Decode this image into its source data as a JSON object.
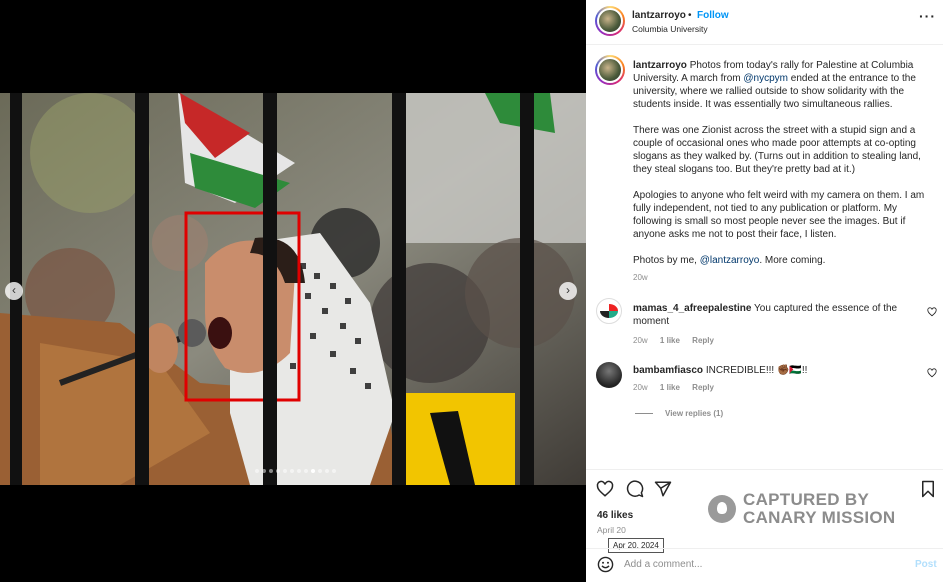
{
  "post": {
    "username": "lantzarroyo",
    "separator": "•",
    "follow_label": "Follow",
    "location": "Columbia University",
    "more_icon": "more-horizontal-icon"
  },
  "caption": {
    "username": "lantzarroyo",
    "p1_a": "Photos from today's rally for Palestine at Columbia University. A march from ",
    "p1_mention": "@nycpym",
    "p1_b": " ended at the entrance to the university, where we rallied outside to show solidarity with the students inside. It was essentially two simultaneous rallies.",
    "p2": "There was one Zionist across the street with a stupid sign and a couple of occasional ones who made poor attempts at co-opting slogans as they walked by. (Turns out in addition to stealing land, they steal slogans too. But they're pretty bad at it.)",
    "p3": "Apologies to anyone who felt weird with my camera on them. I am fully independent, not tied to any publication or platform. My following is small so most people never see the images. But if anyone asks me not to post their face, I listen.",
    "p4_a": "Photos by me, ",
    "p4_mention": "@lantzarroyo",
    "p4_b": ". More coming.",
    "time": "20w"
  },
  "comments": [
    {
      "username": "mamas_4_afreepalestine",
      "text": "You captured the essence of the moment",
      "time": "20w",
      "likes": "1 like",
      "reply": "Reply"
    },
    {
      "username": "bambamfiasco",
      "text": "INCREDIBLE!!! ✊🏾🇵🇸!!",
      "time": "20w",
      "likes": "1 like",
      "reply": "Reply"
    }
  ],
  "view_replies": "View replies (1)",
  "actions": {
    "like_icon": "heart-icon",
    "comment_icon": "comment-icon",
    "share_icon": "share-icon",
    "save_icon": "bookmark-icon"
  },
  "likes": "46 likes",
  "date": "April 20",
  "tooltip": "Apr 20, 2024",
  "comment_box": {
    "placeholder": "Add a comment...",
    "post_label": "Post",
    "emoji_icon": "emoji-icon"
  },
  "watermark": {
    "line1": "CAPTURED BY",
    "line2": "CANARY MISSION"
  },
  "carousel": {
    "prev_icon": "chevron-left-icon",
    "next_icon": "chevron-right-icon",
    "total": 12,
    "active_index": 8,
    "highlight_color": "#e00000"
  },
  "colors": {
    "accent": "#0095f6",
    "mention": "#00376b",
    "muted": "#8e8e8e"
  }
}
